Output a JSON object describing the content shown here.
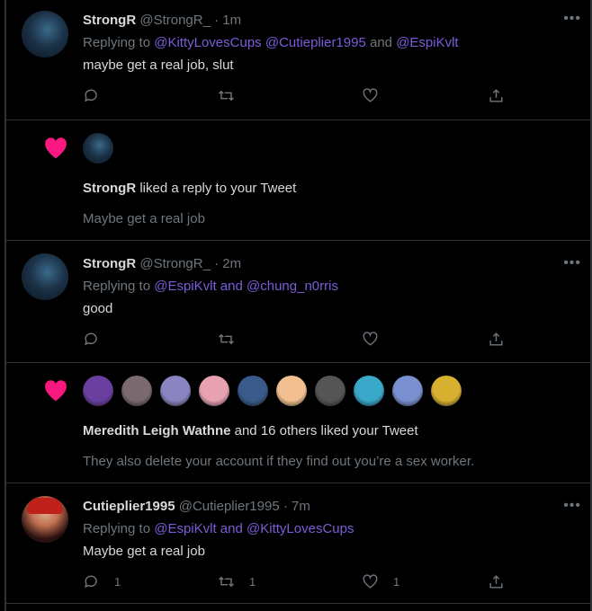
{
  "notifications": [
    {
      "kind": "reply",
      "display_name": "StrongR",
      "handle": "@StrongR_",
      "sep": "·",
      "time": "1m",
      "replying_prefix": "Replying to",
      "mentions": [
        "@KittyLovesCups",
        "@Cutieplier1995",
        "@EspiKvlt"
      ],
      "joiners": [
        " ",
        " and "
      ],
      "text": "maybe get a real job, slut",
      "more_icon": "more-horizontal-icon",
      "counts": {
        "reply": "",
        "retweet": "",
        "like": ""
      }
    },
    {
      "kind": "like",
      "heart_icon": "heart-filled-icon",
      "actor": "StrongR",
      "action_text": " liked a reply to your Tweet",
      "quote": "Maybe get a real job"
    },
    {
      "kind": "reply",
      "display_name": "StrongR",
      "handle": "@StrongR_",
      "sep": "·",
      "time": "2m",
      "replying_prefix": "Replying to",
      "mentions": [
        "@EspiKvlt",
        "@chung_n0rris"
      ],
      "joiners": [
        " and "
      ],
      "text": "good",
      "more_icon": "more-horizontal-icon",
      "counts": {
        "reply": "",
        "retweet": "",
        "like": ""
      }
    },
    {
      "kind": "like-group",
      "heart_icon": "heart-filled-icon",
      "actor": "Meredith Leigh Wathne",
      "action_text": " and 16 others liked your Tweet",
      "quote": "They also delete your account if they find out you’re a sex worker.",
      "avatar_colors": [
        "#6b3fa0",
        "#7a6a70",
        "#8a84c0",
        "#e7a1b0",
        "#3a5a8a",
        "#f2c090",
        "#555555",
        "#3aa8c8",
        "#7a8fd0",
        "#d8b030"
      ]
    },
    {
      "kind": "reply",
      "display_name": "Cutieplier1995",
      "handle": "@Cutieplier1995",
      "sep": "·",
      "time": "7m",
      "replying_prefix": "Replying to",
      "mentions": [
        "@EspiKvlt",
        "@KittyLovesCups"
      ],
      "joiners": [
        " and "
      ],
      "text": "Maybe get a real job",
      "more_icon": "more-horizontal-icon",
      "counts": {
        "reply": "1",
        "retweet": "1",
        "like": "1"
      }
    }
  ],
  "colors": {
    "background": "#000000",
    "link": "#7a5cd9",
    "muted": "#6e767d",
    "heart": "#f91880",
    "divider": "#2f3336"
  }
}
